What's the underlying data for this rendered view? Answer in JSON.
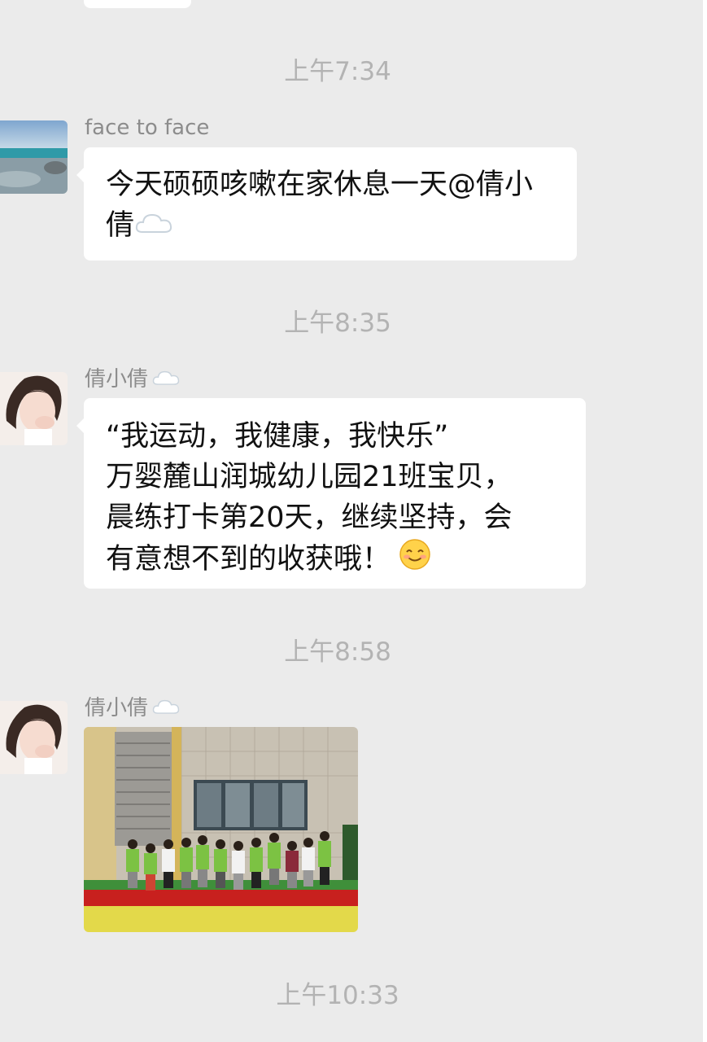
{
  "messages": [
    {
      "time": "上午7:34",
      "sender": "face to face",
      "text": "今天硕硕咳嗽在家休息一天@倩小倩"
    },
    {
      "time": "上午8:35",
      "sender": "倩小倩",
      "lines": [
        "“我运动，我健康，我快乐”",
        "万婴麓山润城幼儿园21班宝贝，",
        "晨练打卡第20天，继续坚持，会",
        "有意想不到的收获哦！"
      ]
    },
    {
      "time": "上午8:58",
      "sender": "倩小倩",
      "type": "image"
    },
    {
      "time": "上午10:33"
    }
  ],
  "icons": {
    "cloud": "cloud-emoji-icon",
    "smile": "smiling-face-emoji-icon"
  },
  "colors": {
    "background": "#ebebeb",
    "bubble": "#ffffff",
    "timestamp": "#b3b3b3",
    "sender": "#8c8c8c"
  }
}
